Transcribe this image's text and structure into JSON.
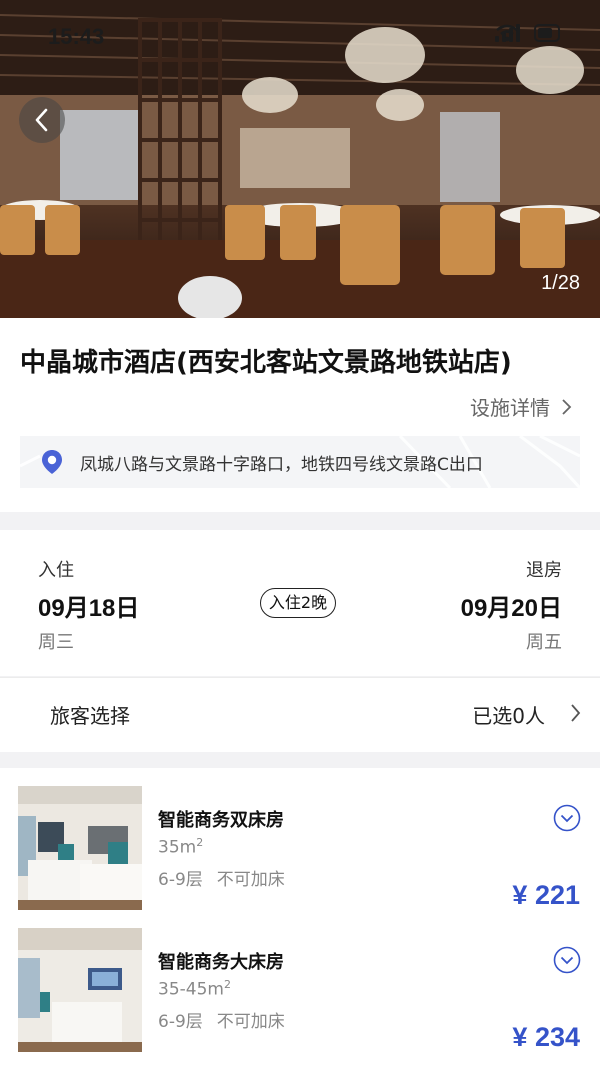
{
  "status_bar": {
    "time": "15:43"
  },
  "hero": {
    "photo_counter": "1/28"
  },
  "hotel": {
    "name": "中晶城市酒店(西安北客站文景路地铁站店)",
    "facility_link": "设施详情",
    "address": "凤城八路与文景路十字路口，地铁四号线文景路C出口"
  },
  "stay": {
    "checkin_label": "入住",
    "checkin_date": "09月18日",
    "checkin_weekday": "周三",
    "nights_badge": "入住2晚",
    "checkout_label": "退房",
    "checkout_date": "09月20日",
    "checkout_weekday": "周五"
  },
  "guests": {
    "label": "旅客选择",
    "value": "已选0人"
  },
  "rooms": [
    {
      "name": "智能商务双床房",
      "size": "35m",
      "floor": "6-9层",
      "extra_bed": "不可加床",
      "price": "¥ 221"
    },
    {
      "name": "智能商务大床房",
      "size": "35-45m",
      "floor": "6-9层",
      "extra_bed": "不可加床",
      "price": "¥ 234"
    }
  ],
  "colors": {
    "accent": "#3553c9",
    "pin": "#4a63d6"
  },
  "icons": [
    "back-arrow-icon",
    "chevron-right-icon",
    "location-pin-icon",
    "chevron-down-circle-icon",
    "wifi-icon",
    "signal-icon",
    "battery-icon"
  ]
}
